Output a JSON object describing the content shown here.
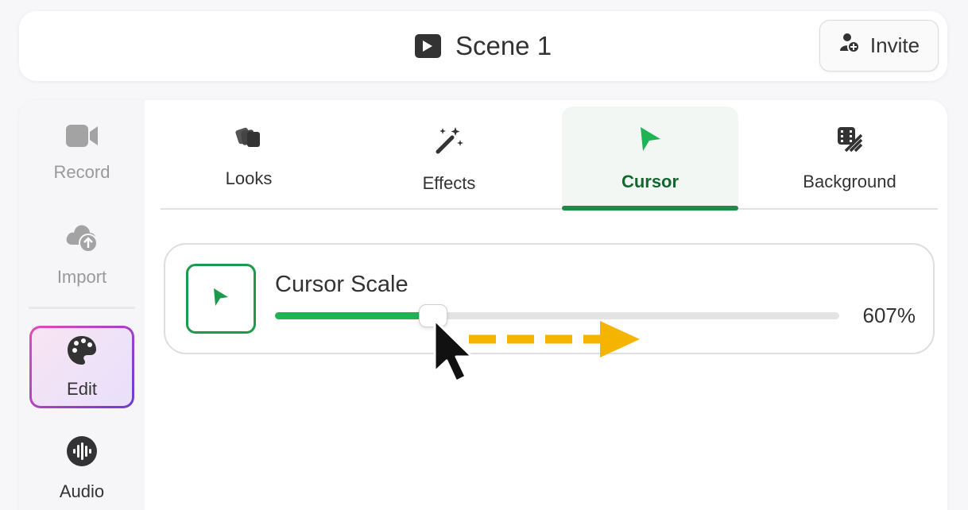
{
  "header": {
    "scene_title": "Scene 1",
    "invite_label": "Invite"
  },
  "sidebar": {
    "items": [
      {
        "label": "Record",
        "icon": "video-camera-icon",
        "state": "dimmed"
      },
      {
        "label": "Import",
        "icon": "cloud-upload-icon",
        "state": "dimmed"
      },
      {
        "label": "Edit",
        "icon": "palette-icon",
        "state": "selected"
      },
      {
        "label": "Audio",
        "icon": "audio-waveform-icon",
        "state": "normal"
      }
    ]
  },
  "tabs": [
    {
      "label": "Looks",
      "icon": "stacked-layers-icon"
    },
    {
      "label": "Effects",
      "icon": "magic-wand-icon"
    },
    {
      "label": "Cursor",
      "icon": "cursor-arrow-icon",
      "active": true
    },
    {
      "label": "Background",
      "icon": "background-pattern-icon"
    }
  ],
  "cursor_scale": {
    "title": "Cursor Scale",
    "value_label": "607%",
    "slider_fraction": 0.28
  },
  "colors": {
    "accent_green": "#1fb356",
    "active_tab_text": "#11692f",
    "edit_gradient_start": "#e84ab2",
    "edit_gradient_end": "#6a3cd6",
    "hint_arrow": "#f5b400"
  }
}
